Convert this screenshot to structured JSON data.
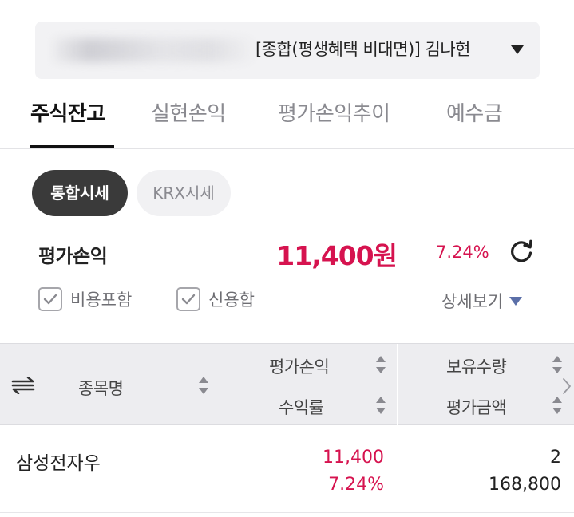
{
  "account": {
    "name": "[종합(평생혜택 비대면)] 김나현",
    "dropdown_icon": "caret-down-icon"
  },
  "tabs": [
    {
      "label": "주식잔고",
      "active": true
    },
    {
      "label": "실현손익",
      "active": false
    },
    {
      "label": "평가손익추이",
      "active": false
    },
    {
      "label": "예수금",
      "active": false
    }
  ],
  "price_toggle": {
    "integrated": "통합시세",
    "krx": "KRX시세",
    "selected": "integrated"
  },
  "summary": {
    "label": "평가손익",
    "amount": "11,400원",
    "rate": "7.24%",
    "refresh_icon": "refresh-icon",
    "include_fees": {
      "label": "비용포함",
      "checked": true
    },
    "credit_sum": {
      "label": "신용합",
      "checked": true
    },
    "detail": "상세보기"
  },
  "table": {
    "headers": {
      "name": "종목명",
      "pnl": "평가손익",
      "rate": "수익률",
      "qty": "보유수량",
      "value": "평가금액"
    },
    "rows": [
      {
        "name": "삼성전자우",
        "pnl": "11,400",
        "rate": "7.24%",
        "qty": "2",
        "value": "168,800"
      }
    ]
  },
  "colors": {
    "accent_red": "#d6134f",
    "dark_pill": "#3a3a3a",
    "header_bg": "#ededf0"
  }
}
